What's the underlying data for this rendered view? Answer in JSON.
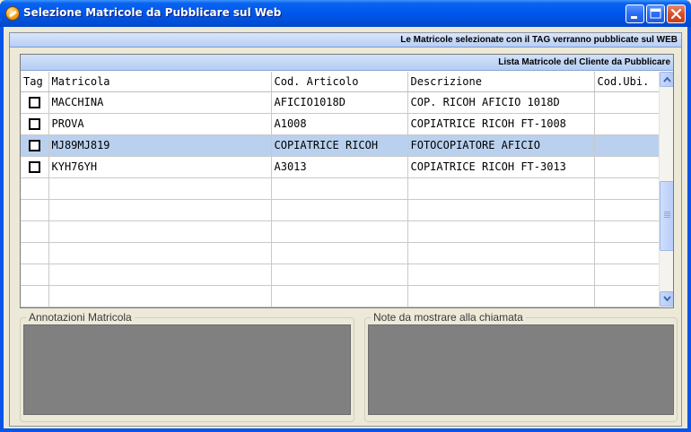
{
  "window": {
    "title": "Selezione Matricole da Pubblicare sul Web"
  },
  "info_bar": {
    "text": "Le Matricole selezionate con il TAG verranno pubblicate sul WEB"
  },
  "grid": {
    "caption": "Lista Matricole del Cliente da Pubblicare",
    "columns": [
      "Tag",
      "Matricola",
      "Cod. Articolo",
      "Descrizione",
      "Cod.Ubi."
    ],
    "rows": [
      {
        "tag": false,
        "matricola": "MACCHINA",
        "cod_articolo": "AFICIO1018D",
        "descrizione": "COP. RICOH AFICIO 1018D",
        "cod_ubi": ""
      },
      {
        "tag": false,
        "matricola": "PROVA",
        "cod_articolo": "A1008",
        "descrizione": "COPIATRICE RICOH FT-1008",
        "cod_ubi": ""
      },
      {
        "tag": false,
        "matricola": "MJ89MJ819",
        "cod_articolo": "COPIATRICE RICOH",
        "descrizione": "FOTOCOPIATORE AFICIO",
        "cod_ubi": ""
      },
      {
        "tag": false,
        "matricola": "KYH76YH",
        "cod_articolo": "A3013",
        "descrizione": "COPIATRICE RICOH FT-3013",
        "cod_ubi": ""
      }
    ],
    "selected_row": 2
  },
  "annotazioni": {
    "label": "Annotazioni Matricola",
    "value": ""
  },
  "note_chiamata": {
    "label": "Note da mostrare alla chiamata",
    "value": ""
  },
  "colors": {
    "title_bar": "#0058ee",
    "selection": "#b9d1ee",
    "note_background": "#808080"
  }
}
